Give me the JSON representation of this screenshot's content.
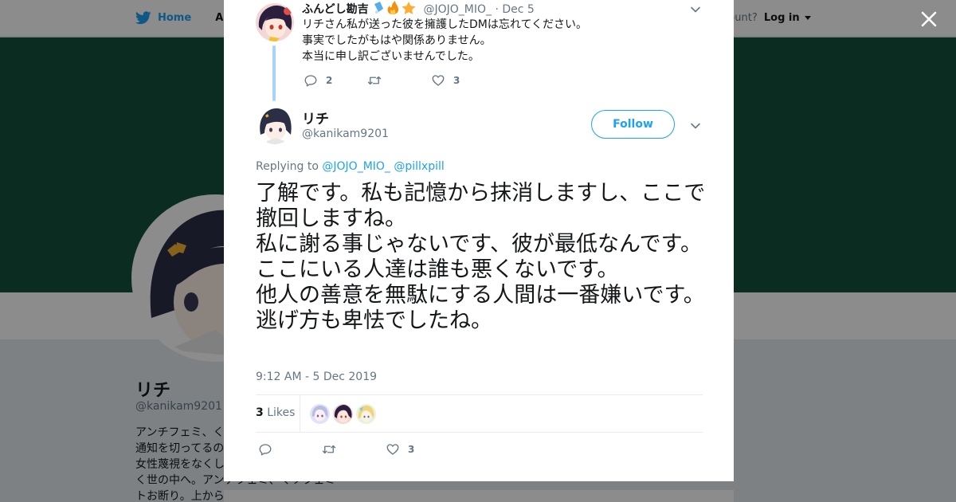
{
  "nav": {
    "home_label": "Home",
    "about_label": "Abo",
    "account_prompt": "ccount?",
    "login_label": "Log in"
  },
  "profile": {
    "name": "リチ",
    "handle": "@kanikam9201",
    "bio": "アンチフェミ、く\n通知を切ってるの\n女性蔑視をなくし\nく世の中へ。アンチフェミ、くソフェミ\nトお断り。上から"
  },
  "parent_tweet": {
    "name": "ふんどし勘吉",
    "handle": "@JOJO_MIO_",
    "date": "· Dec 5",
    "text": "リチさん私が送った彼を擁護したDMは忘れてください。\n事実でしたがもはや関係ありません。\n本当に申し訳ございませんでした。",
    "reply_count": "2",
    "retweet_count": "",
    "like_count": "3"
  },
  "main_tweet": {
    "name": "リチ",
    "handle": "@kanikam9201",
    "follow_label": "Follow",
    "replying_prefix": "Replying to",
    "replying_to_1": "@JOJO_MIO_",
    "replying_to_2": "@pillxpill",
    "text": "了解です。私も記憶から抹消しますし、ここで撤回しますね。\n私に謝る事じゃないです、彼が最低なんです。ここにいる人達は誰も悪くないです。\n他人の善意を無駄にする人間は一番嫌いです。\n逃げ方も卑怯でしたね。",
    "timestamp": "9:12 AM - 5 Dec 2019",
    "likes_count": "3",
    "likes_label": "Likes",
    "reply_count": "",
    "retweet_count": "",
    "like_count": "3"
  },
  "colors": {
    "accent": "#1da1f2",
    "banner": "#14523d",
    "thread_line": "#a6d4fa",
    "text_primary": "#14171a",
    "text_secondary": "#657786"
  },
  "icons": [
    "twitter-bird-icon",
    "close-icon",
    "chevron-down-icon",
    "reply-icon",
    "retweet-icon",
    "heart-icon"
  ]
}
